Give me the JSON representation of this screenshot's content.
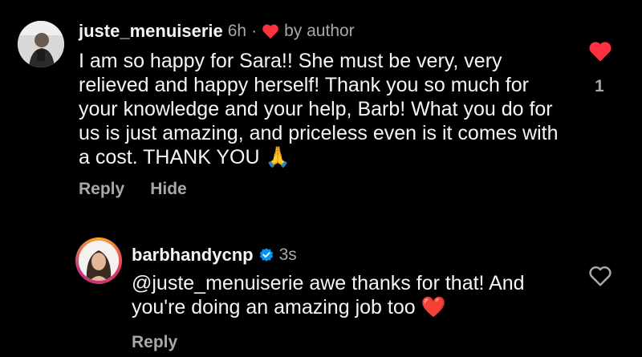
{
  "comment": {
    "username": "juste_menuiserie",
    "time": "6h",
    "separator": "·",
    "by_author": "by author",
    "text": "I am so happy for Sara!! She must be very, very relieved and happy herself! Thank you so much for your knowledge and your help, Barb! What you do for us is just amazing, and priceless even is it comes with a cost. THANK YOU",
    "emoji": "🙏",
    "reply_label": "Reply",
    "hide_label": "Hide",
    "like_count": "1",
    "liked": true
  },
  "reply": {
    "username": "barbhandycnp",
    "time": "3s",
    "mention": "@juste_menuiserie",
    "text": " awe thanks for that! And you're doing an amazing job too",
    "emoji": "❤️",
    "reply_label": "Reply",
    "liked": false
  },
  "colors": {
    "like_red": "#ff3040",
    "verified_blue": "#0095f6",
    "muted": "#a8a8a8"
  }
}
